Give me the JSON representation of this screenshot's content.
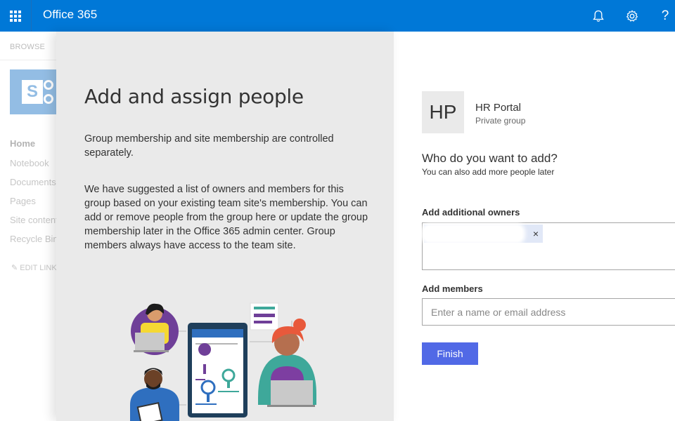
{
  "topbar": {
    "app_title": "Office 365",
    "icons": [
      "app-launcher-icon",
      "bell-icon",
      "gear-icon",
      "help-icon"
    ],
    "help_glyph": "?"
  },
  "background_page": {
    "browse_label": "BROWSE",
    "nav": [
      "Home",
      "Notebook",
      "Documents",
      "Pages",
      "Site contents",
      "Recycle Bin"
    ],
    "edit_links": "EDIT LINKS"
  },
  "left_panel": {
    "title": "Add and assign people",
    "paragraph1": "Group membership and site membership are controlled separately.",
    "paragraph2": "We have suggested a list of owners and members for this group based on your existing team site's membership. You can add or remove people from the group here or update the group membership later in the Office 365 admin center. Group members always have access to the team site."
  },
  "group": {
    "initials": "HP",
    "name": "HR Portal",
    "type": "Private group"
  },
  "form": {
    "who_title": "Who do you want to add?",
    "who_subtitle": "You can also add more people later",
    "owners_label": "Add additional owners",
    "owner_chip_remove": "×",
    "members_label": "Add members",
    "members_placeholder": "Enter a name or email address",
    "finish_label": "Finish"
  },
  "colors": {
    "suitebar": "#0078d7",
    "finish_button": "#5169e6",
    "panel_bg": "#eaeaea",
    "chip_bg": "#e1e8f7"
  }
}
